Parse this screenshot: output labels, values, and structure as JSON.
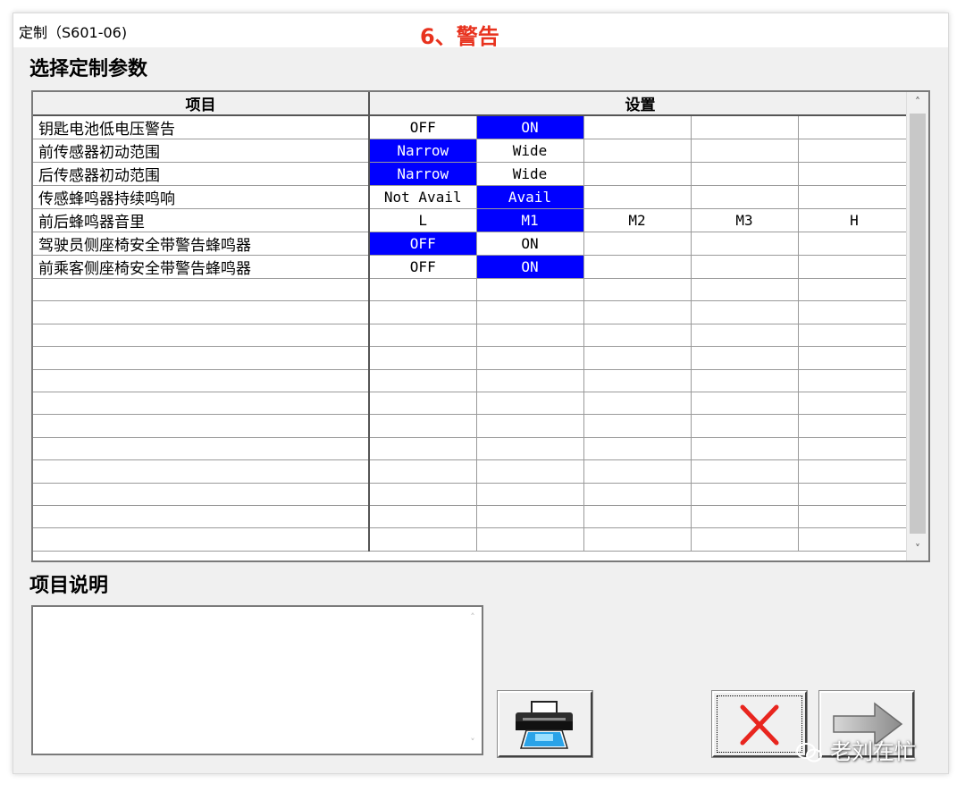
{
  "window": {
    "title": "定制（S601-06)"
  },
  "annotation": "6、警告",
  "params_section": {
    "heading": "选择定制参数",
    "headers": {
      "item": "项目",
      "setting": "设置"
    },
    "rows": [
      {
        "item": "钥匙电池低电压警告",
        "options": [
          "OFF",
          "ON",
          "",
          "",
          ""
        ],
        "selected": 1
      },
      {
        "item": "前传感器初动范围",
        "options": [
          "Narrow",
          "Wide",
          "",
          "",
          ""
        ],
        "selected": 0
      },
      {
        "item": "后传感器初动范围",
        "options": [
          "Narrow",
          "Wide",
          "",
          "",
          ""
        ],
        "selected": 0
      },
      {
        "item": "传感蜂鸣器持续鸣响",
        "options": [
          "Not Avail",
          "Avail",
          "",
          "",
          ""
        ],
        "selected": 1
      },
      {
        "item": "前后蜂鸣器音里",
        "options": [
          "L",
          "M1",
          "M2",
          "M3",
          "H"
        ],
        "selected": 1
      },
      {
        "item": "驾驶员侧座椅安全带警告蜂鸣器",
        "options": [
          "OFF",
          "ON",
          "",
          "",
          ""
        ],
        "selected": 0
      },
      {
        "item": "前乘客侧座椅安全带警告蜂鸣器",
        "options": [
          "OFF",
          "ON",
          "",
          "",
          ""
        ],
        "selected": 1
      }
    ],
    "empty_rows": 12
  },
  "description_section": {
    "heading": "项目说明",
    "text": ""
  },
  "icons": {
    "print": "printer-icon",
    "cancel": "red-x-icon",
    "next": "gray-arrow-right-icon",
    "watermark": "wechat-icon"
  },
  "colors": {
    "selected_bg": "#0000ff",
    "cancel_x": "#e8251e",
    "annotation": "#e8321e"
  },
  "watermark": "老刘在忙"
}
